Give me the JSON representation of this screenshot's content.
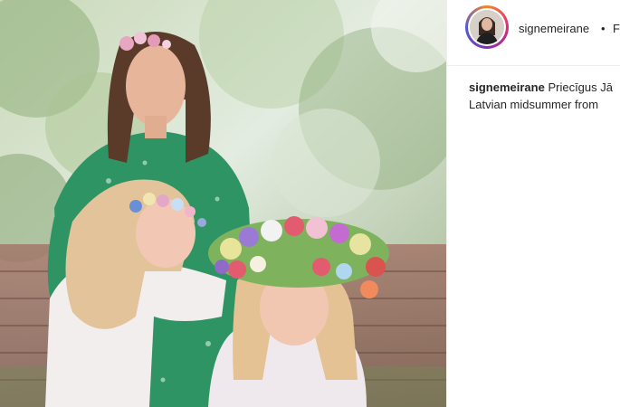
{
  "post": {
    "username": "signemeirane",
    "separator": "•",
    "follow_label": "F",
    "caption_user": "signemeirane",
    "caption_line1": "Priecīgus Jā",
    "caption_line2": "Latvian midsummer from"
  },
  "icons": {
    "avatar": "profile-photo"
  },
  "colors": {
    "text": "#262626",
    "divider": "#efefef",
    "dress": "#2e8b57"
  }
}
